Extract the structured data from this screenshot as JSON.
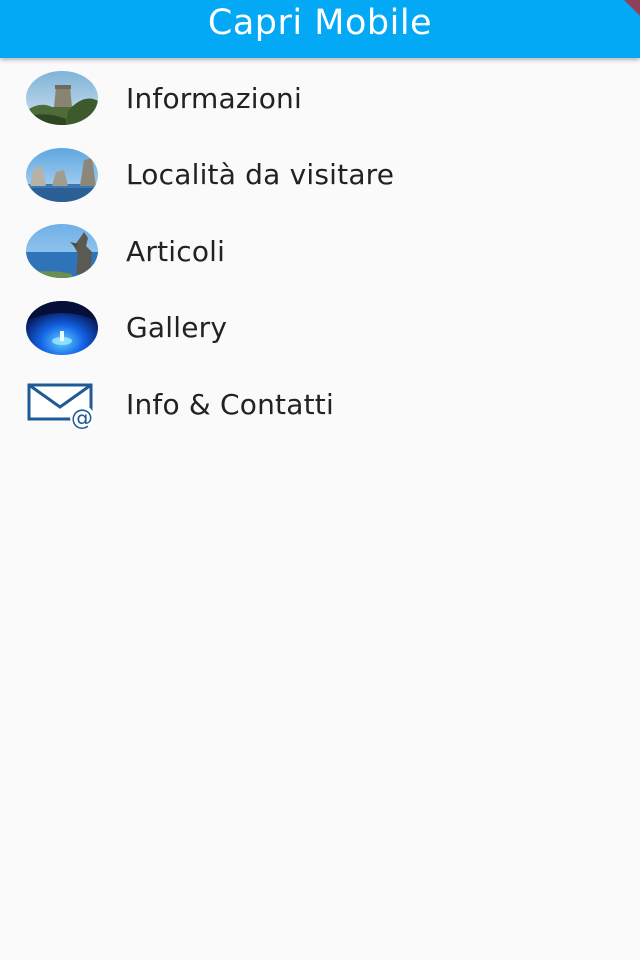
{
  "appbar": {
    "title": "Capri Mobile",
    "color": "#03a9f4"
  },
  "menu": {
    "items": [
      {
        "label": "Informazioni",
        "icon": "tower-landscape-photo-icon"
      },
      {
        "label": "Località da visitare",
        "icon": "faraglioni-rocks-photo-icon"
      },
      {
        "label": "Articoli",
        "icon": "statue-sea-photo-icon"
      },
      {
        "label": "Gallery",
        "icon": "blue-grotto-photo-icon"
      },
      {
        "label": "Info & Contatti",
        "icon": "envelope-at-icon"
      }
    ]
  },
  "colors": {
    "background": "#fafafa",
    "text": "#222222"
  }
}
